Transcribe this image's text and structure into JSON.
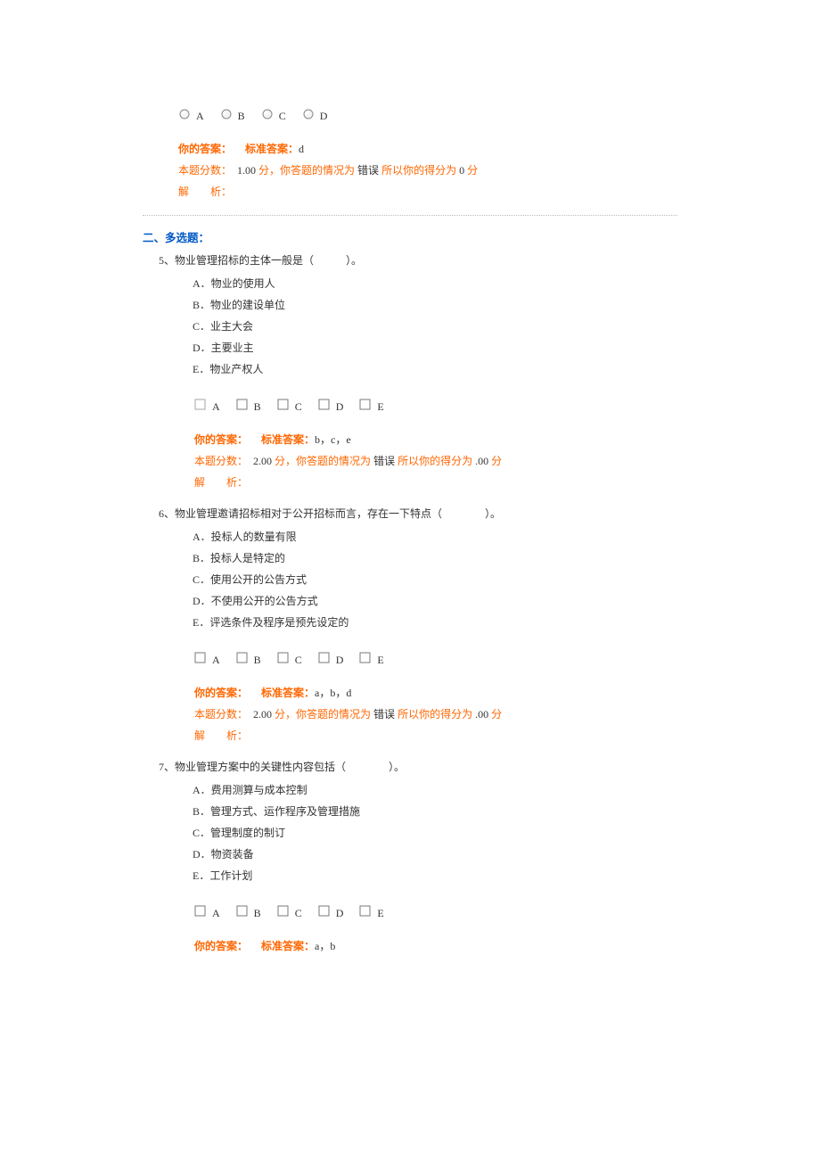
{
  "opts": {
    "A": "A",
    "B": "B",
    "C": "C",
    "D": "D",
    "E": "E"
  },
  "labels": {
    "your_ans": "你的答案：",
    "std_ans": "标准答案：",
    "score_prefix": "本题分数：",
    "fen": " 分，",
    "status_prefix": "你答题的情况为",
    "wrong": " 错误 ",
    "so": "所以你的得分为",
    "tail_fen": " 分",
    "analysis": "解　　析："
  },
  "section2": "二、多选题：",
  "q4": {
    "std": "d",
    "score": "1.00",
    "got": " 0"
  },
  "q5": {
    "stem": "5、物业管理招标的主体一般是（　　　）。",
    "a": "A．物业的使用人",
    "b": "B．物业的建设单位",
    "c": "C．业主大会",
    "d": "D．主要业主",
    "e": "E．物业产权人",
    "std": "b，c，e",
    "score": "2.00",
    "got": " .00"
  },
  "q6": {
    "stem": "6、物业管理邀请招标相对于公开招标而言，存在一下特点（　　　　）。",
    "a": "A．投标人的数量有限",
    "b": "B．投标人是特定的",
    "c": "C．使用公开的公告方式",
    "d": "D．不使用公开的公告方式",
    "e": "E．评选条件及程序是预先设定的",
    "std": "a，b，d",
    "score": "2.00",
    "got": " .00"
  },
  "q7": {
    "stem": "7、物业管理方案中的关键性内容包括（　　　　）。",
    "a": "A．费用测算与成本控制",
    "b": "B．管理方式、运作程序及管理措施",
    "c": "C．管理制度的制订",
    "d": "D．物资装备",
    "e": "E．工作计划",
    "std": "a，b"
  }
}
